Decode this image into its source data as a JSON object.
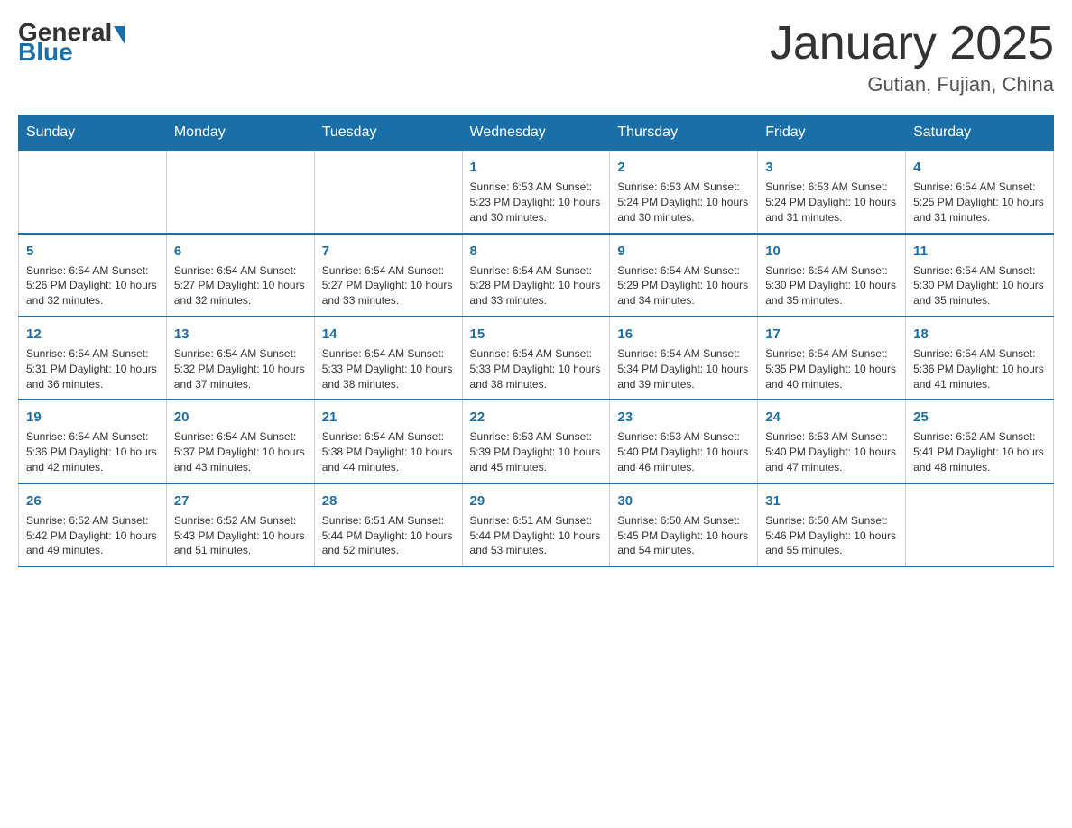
{
  "header": {
    "logo_general": "General",
    "logo_blue": "Blue",
    "month_title": "January 2025",
    "location": "Gutian, Fujian, China"
  },
  "weekdays": [
    "Sunday",
    "Monday",
    "Tuesday",
    "Wednesday",
    "Thursday",
    "Friday",
    "Saturday"
  ],
  "weeks": [
    {
      "days": [
        {
          "number": "",
          "info": ""
        },
        {
          "number": "",
          "info": ""
        },
        {
          "number": "",
          "info": ""
        },
        {
          "number": "1",
          "info": "Sunrise: 6:53 AM\nSunset: 5:23 PM\nDaylight: 10 hours and 30 minutes."
        },
        {
          "number": "2",
          "info": "Sunrise: 6:53 AM\nSunset: 5:24 PM\nDaylight: 10 hours and 30 minutes."
        },
        {
          "number": "3",
          "info": "Sunrise: 6:53 AM\nSunset: 5:24 PM\nDaylight: 10 hours and 31 minutes."
        },
        {
          "number": "4",
          "info": "Sunrise: 6:54 AM\nSunset: 5:25 PM\nDaylight: 10 hours and 31 minutes."
        }
      ]
    },
    {
      "days": [
        {
          "number": "5",
          "info": "Sunrise: 6:54 AM\nSunset: 5:26 PM\nDaylight: 10 hours and 32 minutes."
        },
        {
          "number": "6",
          "info": "Sunrise: 6:54 AM\nSunset: 5:27 PM\nDaylight: 10 hours and 32 minutes."
        },
        {
          "number": "7",
          "info": "Sunrise: 6:54 AM\nSunset: 5:27 PM\nDaylight: 10 hours and 33 minutes."
        },
        {
          "number": "8",
          "info": "Sunrise: 6:54 AM\nSunset: 5:28 PM\nDaylight: 10 hours and 33 minutes."
        },
        {
          "number": "9",
          "info": "Sunrise: 6:54 AM\nSunset: 5:29 PM\nDaylight: 10 hours and 34 minutes."
        },
        {
          "number": "10",
          "info": "Sunrise: 6:54 AM\nSunset: 5:30 PM\nDaylight: 10 hours and 35 minutes."
        },
        {
          "number": "11",
          "info": "Sunrise: 6:54 AM\nSunset: 5:30 PM\nDaylight: 10 hours and 35 minutes."
        }
      ]
    },
    {
      "days": [
        {
          "number": "12",
          "info": "Sunrise: 6:54 AM\nSunset: 5:31 PM\nDaylight: 10 hours and 36 minutes."
        },
        {
          "number": "13",
          "info": "Sunrise: 6:54 AM\nSunset: 5:32 PM\nDaylight: 10 hours and 37 minutes."
        },
        {
          "number": "14",
          "info": "Sunrise: 6:54 AM\nSunset: 5:33 PM\nDaylight: 10 hours and 38 minutes."
        },
        {
          "number": "15",
          "info": "Sunrise: 6:54 AM\nSunset: 5:33 PM\nDaylight: 10 hours and 38 minutes."
        },
        {
          "number": "16",
          "info": "Sunrise: 6:54 AM\nSunset: 5:34 PM\nDaylight: 10 hours and 39 minutes."
        },
        {
          "number": "17",
          "info": "Sunrise: 6:54 AM\nSunset: 5:35 PM\nDaylight: 10 hours and 40 minutes."
        },
        {
          "number": "18",
          "info": "Sunrise: 6:54 AM\nSunset: 5:36 PM\nDaylight: 10 hours and 41 minutes."
        }
      ]
    },
    {
      "days": [
        {
          "number": "19",
          "info": "Sunrise: 6:54 AM\nSunset: 5:36 PM\nDaylight: 10 hours and 42 minutes."
        },
        {
          "number": "20",
          "info": "Sunrise: 6:54 AM\nSunset: 5:37 PM\nDaylight: 10 hours and 43 minutes."
        },
        {
          "number": "21",
          "info": "Sunrise: 6:54 AM\nSunset: 5:38 PM\nDaylight: 10 hours and 44 minutes."
        },
        {
          "number": "22",
          "info": "Sunrise: 6:53 AM\nSunset: 5:39 PM\nDaylight: 10 hours and 45 minutes."
        },
        {
          "number": "23",
          "info": "Sunrise: 6:53 AM\nSunset: 5:40 PM\nDaylight: 10 hours and 46 minutes."
        },
        {
          "number": "24",
          "info": "Sunrise: 6:53 AM\nSunset: 5:40 PM\nDaylight: 10 hours and 47 minutes."
        },
        {
          "number": "25",
          "info": "Sunrise: 6:52 AM\nSunset: 5:41 PM\nDaylight: 10 hours and 48 minutes."
        }
      ]
    },
    {
      "days": [
        {
          "number": "26",
          "info": "Sunrise: 6:52 AM\nSunset: 5:42 PM\nDaylight: 10 hours and 49 minutes."
        },
        {
          "number": "27",
          "info": "Sunrise: 6:52 AM\nSunset: 5:43 PM\nDaylight: 10 hours and 51 minutes."
        },
        {
          "number": "28",
          "info": "Sunrise: 6:51 AM\nSunset: 5:44 PM\nDaylight: 10 hours and 52 minutes."
        },
        {
          "number": "29",
          "info": "Sunrise: 6:51 AM\nSunset: 5:44 PM\nDaylight: 10 hours and 53 minutes."
        },
        {
          "number": "30",
          "info": "Sunrise: 6:50 AM\nSunset: 5:45 PM\nDaylight: 10 hours and 54 minutes."
        },
        {
          "number": "31",
          "info": "Sunrise: 6:50 AM\nSunset: 5:46 PM\nDaylight: 10 hours and 55 minutes."
        },
        {
          "number": "",
          "info": ""
        }
      ]
    }
  ]
}
